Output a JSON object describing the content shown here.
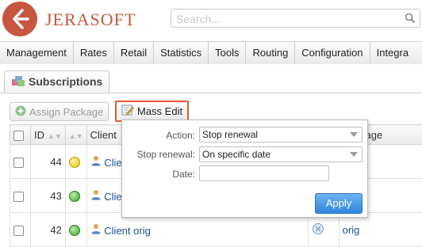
{
  "app": {
    "logo_text": "JERASOFT"
  },
  "search": {
    "placeholder": "Search..."
  },
  "menu": [
    "Management",
    "Rates",
    "Retail",
    "Statistics",
    "Tools",
    "Routing",
    "Configuration",
    "Integra"
  ],
  "page": {
    "tab_title": "Subscriptions"
  },
  "toolbar": {
    "assign_label": "Assign Package",
    "mass_edit_label": "Mass Edit"
  },
  "table": {
    "columns": {
      "id": "ID",
      "client": "Client",
      "package": "Package"
    },
    "rows": [
      {
        "id": "44",
        "status": "yellow",
        "client": "Client",
        "package": ""
      },
      {
        "id": "43",
        "status": "green",
        "client": "Client",
        "package": ""
      },
      {
        "id": "42",
        "status": "green",
        "client": "Client orig",
        "package": "orig"
      }
    ]
  },
  "mass_edit": {
    "action_label": "Action:",
    "action_value": "Stop renewal",
    "stop_renewal_label": "Stop renewal:",
    "stop_renewal_value": "On specific date",
    "date_label": "Date:",
    "date_value": "",
    "apply_label": "Apply"
  },
  "colors": {
    "brand": "#c8553d",
    "highlight": "#e8572f",
    "apply": "#3b8ee0",
    "link": "#1a4f9c"
  }
}
